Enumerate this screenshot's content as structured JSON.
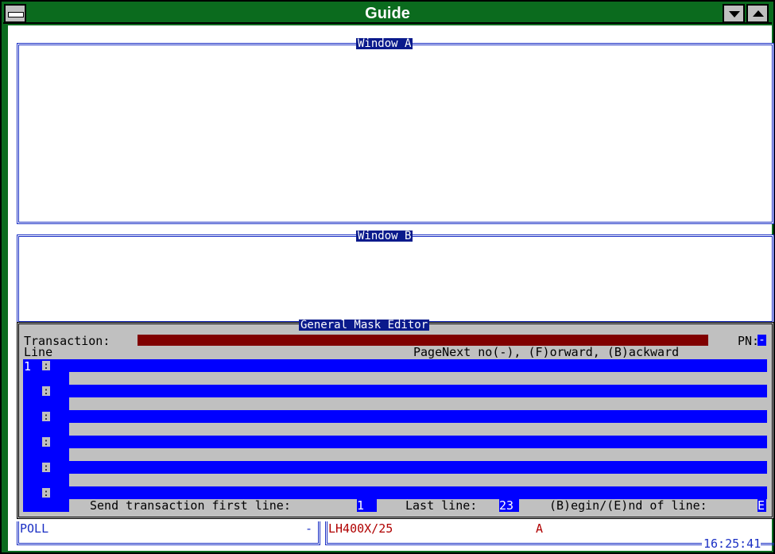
{
  "window": {
    "title": "Guide"
  },
  "window_a": {
    "title": "Window A"
  },
  "window_b": {
    "title": "Window B"
  },
  "mask_editor": {
    "title": "General Mask Editor",
    "transaction_label": "Transaction:",
    "pn_label": "PN:",
    "pn_value": "-",
    "line_label": "Line",
    "page_hint": "PageNext no(-), (F)orward, (B)ackward",
    "rows": [
      {
        "number": "1",
        "marker": ":"
      },
      {
        "number": "",
        "marker": ":"
      },
      {
        "number": "",
        "marker": ":"
      },
      {
        "number": "",
        "marker": ":"
      },
      {
        "number": "",
        "marker": ":"
      },
      {
        "number": "",
        "marker": ":"
      }
    ],
    "send_label": "Send transaction first line:",
    "first_line_value": "1",
    "last_label": "Last line:",
    "last_line_value": "23",
    "begin_end_label": "(B)egin/(E)nd of line:",
    "begin_end_value": "E"
  },
  "status": {
    "mode": "POLL",
    "mode_suffix": "-",
    "terminal": "LH400X/25",
    "flag": "A",
    "clock": "16:25:41"
  },
  "colors": {
    "title_bar": "#0b6b1e",
    "frame_line": "#1a2fc4",
    "field_blue": "#0000ff",
    "transaction_field": "#800000",
    "panel_gray": "#c0c0c0"
  }
}
